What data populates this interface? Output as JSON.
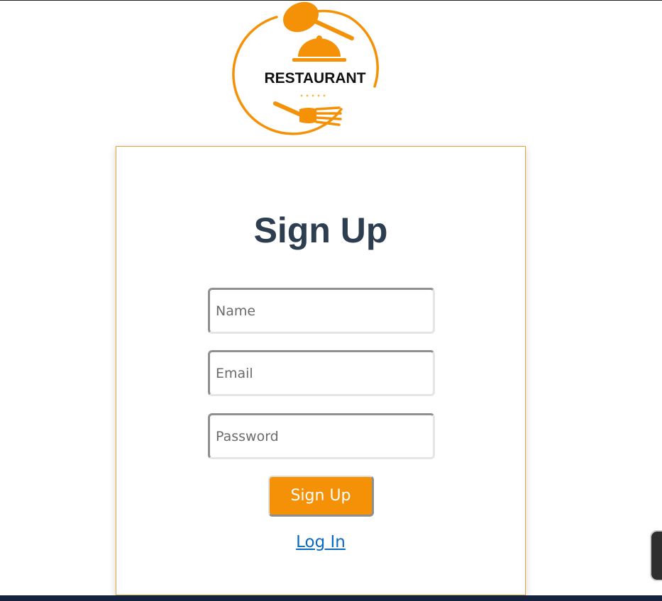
{
  "logo": {
    "brand_text": "RESTAURANT",
    "accent_color": "#f59107",
    "icon": "restaurant-cloche-logo"
  },
  "signup": {
    "title": "Sign Up",
    "name_placeholder": "Name",
    "email_placeholder": "Email",
    "password_placeholder": "Password",
    "submit_label": "Sign Up",
    "login_link": "Log In"
  },
  "colors": {
    "accent": "#f59107",
    "heading": "#2c3e50",
    "link": "#0969c3",
    "footer": "#16233e"
  }
}
